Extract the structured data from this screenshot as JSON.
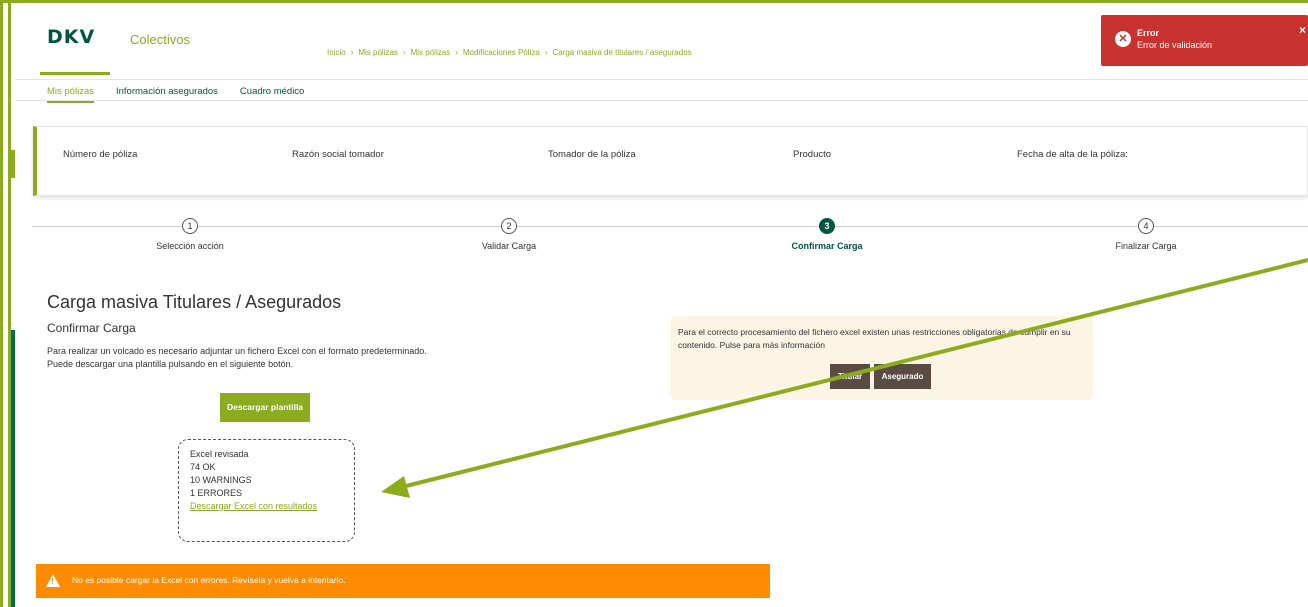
{
  "header": {
    "logo": "DKV",
    "brand_sub": "Colectivos",
    "breadcrumb": [
      "Inicio",
      "Mis pólizas",
      "Mis pólizas",
      "Modificaciones Póliza",
      "Carga masiva de titulares / asegurados"
    ]
  },
  "toast": {
    "title": "Error",
    "message": "Error de validación",
    "close": "×"
  },
  "tabs": [
    {
      "label": "Mis pólizas",
      "active": true
    },
    {
      "label": "Información asegurados",
      "active": false
    },
    {
      "label": "Cuadro médico",
      "active": false
    }
  ],
  "policy": {
    "numero": "Número de póliza",
    "razon": "Razón social tomador",
    "tomador": "Tomador de la póliza",
    "producto": "Producto",
    "fecha": "Fecha de alta de la póliza:"
  },
  "stepper": {
    "current": 3,
    "steps": [
      {
        "number": "1",
        "label": "Selección acción"
      },
      {
        "number": "2",
        "label": "Validar Carga"
      },
      {
        "number": "3",
        "label": "Confirmar Carga"
      },
      {
        "number": "4",
        "label": "Finalizar Carga"
      }
    ]
  },
  "main": {
    "title": "Carga masiva Titulares / Asegurados",
    "section_title": "Confirmar Carga",
    "desc_line1": "Para realizar un volcado es necesario adjuntar un fichero Excel con el formato predeterminado.",
    "desc_line2": "Puede descargar una plantilla pulsando en el siguiente botón.",
    "download_button": "Descargar plantilla"
  },
  "results": {
    "line1": "Excel revisada",
    "line2": "74 OK",
    "line3": "10 WARNINGS",
    "line4": "1 ERRORES",
    "link": "Descargar Excel con resultados"
  },
  "info": {
    "text": "Para el correcto procesamiento del fichero excel existen unas restricciones obligatorias de cumplir en su contenido. Pulse para más información",
    "button_titular": "Titular",
    "button_asegurado": "Asegurado"
  },
  "alert": {
    "text": "No es posible cargar la Excel con errores. Revísela y vuelva a intentarlo."
  },
  "colors": {
    "brand_green": "#8cab1e",
    "dark_green": "#00563f",
    "error_red": "#c8322f",
    "warning_orange": "#ff8c00",
    "info_bg": "#fcf5e6",
    "button_brown": "#5a4c43"
  },
  "icons": {
    "toast": "error-circle-x-icon",
    "alert": "warning-triangle-icon"
  }
}
